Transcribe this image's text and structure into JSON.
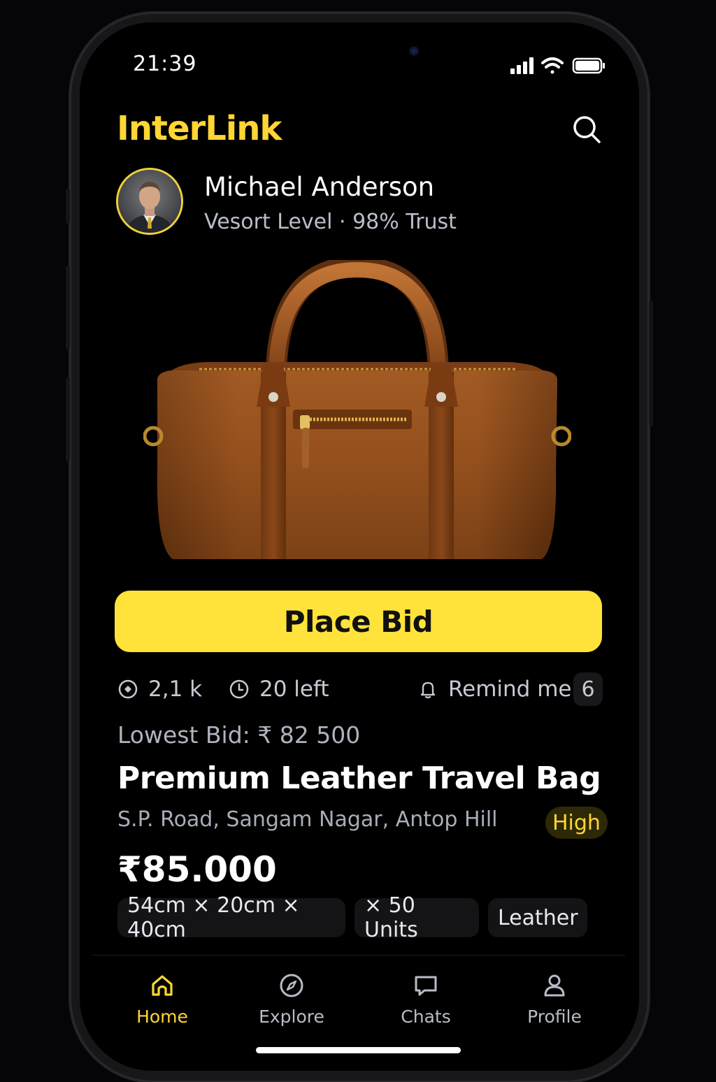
{
  "status_bar": {
    "time": "21:39"
  },
  "header": {
    "brand": "InterLink"
  },
  "seller": {
    "name": "Michael Anderson",
    "meta": "Vesort Level · 98% Trust"
  },
  "product": {
    "cta_label": "Place Bid",
    "views": "2,1 k",
    "stock_left": "20 left",
    "remind_label": "Remind me",
    "remind_count": "6",
    "lowest_bid": "Lowest Bid: ₹ 82 500",
    "title": "Premium Leather Travel Bag",
    "address": "S.P. Road, Sangam Nagar, Antop Hill",
    "demand_badge": "High",
    "price": "₹85.000",
    "chips": [
      "54cm × 20cm × 40cm",
      "× 50 Units",
      "Leather"
    ]
  },
  "tab_bar": {
    "items": [
      {
        "label": "Home",
        "icon": "home-icon",
        "active": true
      },
      {
        "label": "Explore",
        "icon": "compass-icon",
        "active": false
      },
      {
        "label": "Chats",
        "icon": "chat-icon",
        "active": false
      },
      {
        "label": "Profile",
        "icon": "user-icon",
        "active": false
      }
    ]
  },
  "colors": {
    "accent": "#ffe33a",
    "brand": "#ffd633",
    "background": "#000000"
  }
}
